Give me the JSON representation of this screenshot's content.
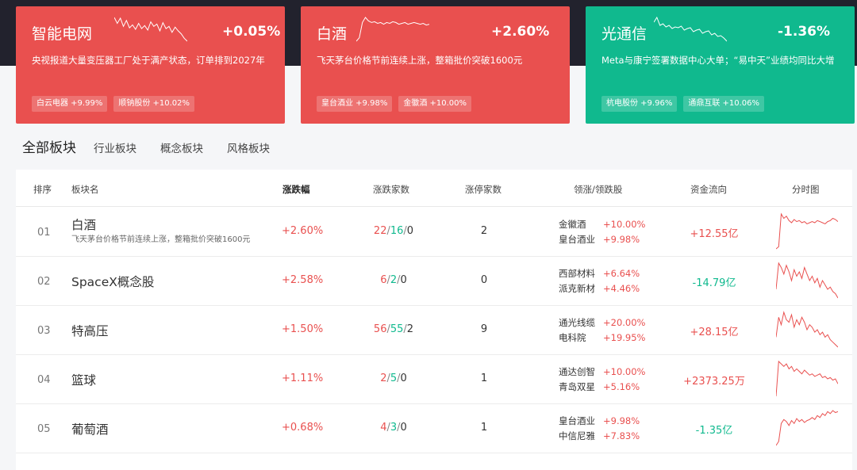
{
  "colors": {
    "up": "#e9504f",
    "down": "#10b98e"
  },
  "cards": [
    {
      "name": "智能电网",
      "change": "+0.05%",
      "news": "央视报道大量变压器工厂处于满产状态，订单排到2027年",
      "chips": [
        "白云电器 +9.99%",
        "顺钠股份 +10.02%"
      ],
      "trend": [
        2,
        10,
        3,
        14,
        6,
        16,
        12,
        18,
        10,
        17,
        13,
        19,
        8,
        14,
        11,
        20,
        9,
        17,
        14,
        22,
        15,
        20,
        24,
        30,
        34
      ]
    },
    {
      "name": "白酒",
      "change": "+2.60%",
      "news": "飞天茅台价格节前连续上涨，整箱批价突破1600元",
      "chips": [
        "皇台酒业 +9.98%",
        "金徽酒 +10.00%"
      ],
      "trend": [
        34,
        30,
        12,
        6,
        10,
        12,
        11,
        13,
        12,
        14,
        12,
        13,
        11,
        12,
        14,
        13,
        12,
        14,
        13,
        12,
        13,
        14,
        13,
        15,
        14
      ]
    },
    {
      "name": "光通信",
      "change": "-1.36%",
      "news": "Meta与康宁签署数据中心大单；“易中天”业绩均同比大增",
      "chips": [
        "杭电股份 +9.96%",
        "通鼎互联 +10.06%"
      ],
      "trend": [
        8,
        2,
        12,
        10,
        14,
        12,
        16,
        14,
        15,
        13,
        18,
        16,
        15,
        20,
        18,
        17,
        22,
        20,
        19,
        24,
        22,
        26,
        25,
        28,
        32
      ]
    }
  ],
  "tabs": [
    "全部板块",
    "行业板块",
    "概念板块",
    "风格板块"
  ],
  "columns": {
    "idx": "排序",
    "name": "板块名",
    "change": "涨跌幅",
    "count": "涨跌家数",
    "limit": "涨停家数",
    "leaders": "领涨/领跌股",
    "flow": "资金流向",
    "minute": "分时图"
  },
  "rows": [
    {
      "idx": "01",
      "name": "白酒",
      "desc": "飞天茅台价格节前连续上涨，整箱批价突破1600元",
      "change": "+2.60%",
      "up": "22",
      "down": "16",
      "flat": "0",
      "limit": "2",
      "leaders": [
        {
          "name": "金徽酒",
          "pct": "+10.00%"
        },
        {
          "name": "皇台酒业",
          "pct": "+9.98%"
        }
      ],
      "flow": "+12.55亿",
      "flow_dir": "up",
      "trend": [
        40,
        38,
        8,
        12,
        10,
        14,
        16,
        13,
        15,
        14,
        16,
        15,
        17,
        16,
        15,
        16,
        14,
        15,
        16,
        17,
        15,
        14,
        12,
        13,
        15
      ]
    },
    {
      "idx": "02",
      "name": "SpaceX概念股",
      "desc": "",
      "change": "+2.58%",
      "up": "6",
      "down": "2",
      "flat": "0",
      "limit": "0",
      "leaders": [
        {
          "name": "西部材料",
          "pct": "+6.64%"
        },
        {
          "name": "派克新材",
          "pct": "+4.46%"
        }
      ],
      "flow": "-14.79亿",
      "flow_dir": "down",
      "trend": [
        30,
        6,
        10,
        16,
        8,
        14,
        22,
        12,
        18,
        14,
        20,
        10,
        16,
        22,
        18,
        24,
        20,
        28,
        22,
        26,
        30,
        28,
        32,
        34,
        38
      ]
    },
    {
      "idx": "03",
      "name": "特高压",
      "desc": "",
      "change": "+1.50%",
      "up": "56",
      "down": "55",
      "flat": "2",
      "limit": "9",
      "leaders": [
        {
          "name": "通光线缆",
          "pct": "+20.00%"
        },
        {
          "name": "电科院",
          "pct": "+19.95%"
        }
      ],
      "flow": "+28.15亿",
      "flow_dir": "up",
      "trend": [
        28,
        12,
        18,
        8,
        14,
        16,
        10,
        20,
        14,
        18,
        12,
        16,
        22,
        18,
        20,
        24,
        22,
        26,
        24,
        28,
        26,
        30,
        32,
        34,
        36
      ]
    },
    {
      "idx": "04",
      "name": "篮球",
      "desc": "",
      "change": "+1.11%",
      "up": "2",
      "down": "5",
      "flat": "0",
      "limit": "1",
      "leaders": [
        {
          "name": "通达创智",
          "pct": "+10.00%"
        },
        {
          "name": "青岛双星",
          "pct": "+5.16%"
        }
      ],
      "flow": "+2373.25万",
      "flow_dir": "up",
      "trend": [
        36,
        8,
        10,
        12,
        10,
        14,
        12,
        16,
        14,
        16,
        18,
        15,
        17,
        19,
        18,
        20,
        19,
        18,
        21,
        20,
        22,
        21,
        23,
        22,
        26
      ]
    },
    {
      "idx": "05",
      "name": "葡萄酒",
      "desc": "",
      "change": "+0.68%",
      "up": "4",
      "down": "3",
      "flat": "0",
      "limit": "1",
      "leaders": [
        {
          "name": "皇台酒业",
          "pct": "+9.98%"
        },
        {
          "name": "中信尼雅",
          "pct": "+7.83%"
        }
      ],
      "flow": "-1.35亿",
      "flow_dir": "down",
      "trend": [
        42,
        38,
        20,
        16,
        18,
        22,
        17,
        20,
        15,
        18,
        16,
        19,
        17,
        16,
        14,
        16,
        12,
        14,
        10,
        12,
        8,
        10,
        7,
        9,
        8
      ]
    }
  ]
}
